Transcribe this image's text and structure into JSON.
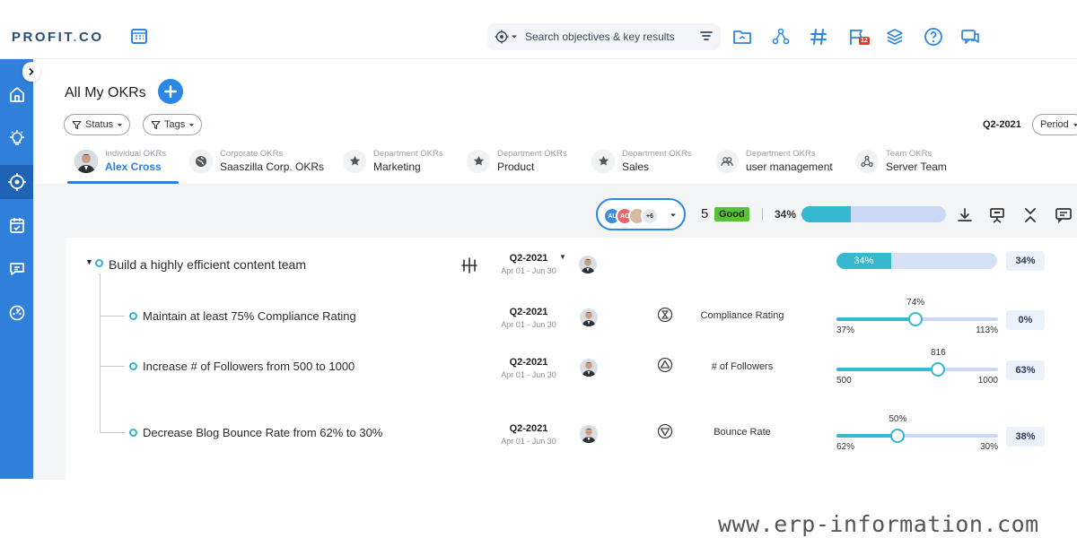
{
  "app": {
    "logo_text": "PROFIT",
    "logo_dot": ".",
    "logo_suffix": "CO"
  },
  "search": {
    "placeholder": "Search objectives & key results"
  },
  "top_icons": [
    "folder-icon",
    "hierarchy-icon",
    "hashtag-icon",
    "flag-icon",
    "layers-icon",
    "help-icon",
    "chat-icon"
  ],
  "notification_count": "12",
  "page": {
    "title": "All My OKRs",
    "filters": {
      "status": "Status",
      "tags": "Tags"
    },
    "period_value": "Q2-2021",
    "period_label": "Period"
  },
  "tabs": [
    {
      "type": "Individual OKRs",
      "name": "Alex Cross",
      "icon": "avatar",
      "active": true
    },
    {
      "type": "Corporate OKRs",
      "name": "Saaszilla Corp. OKRs",
      "icon": "globe-icon"
    },
    {
      "type": "Department OKRs",
      "name": "Marketing",
      "icon": "star-icon"
    },
    {
      "type": "Department OKRs",
      "name": "Product",
      "icon": "star-icon"
    },
    {
      "type": "Department OKRs",
      "name": "Sales",
      "icon": "star-icon"
    },
    {
      "type": "Department OKRs",
      "name": "user management",
      "icon": "users-icon"
    },
    {
      "type": "Team OKRs",
      "name": "Server Team",
      "icon": "team-icon"
    }
  ],
  "toolbar": {
    "members": [
      "AL",
      "AC"
    ],
    "members_more": "+6",
    "score": "5",
    "score_label": "Good",
    "progress_text": "34%",
    "progress": 0.34
  },
  "objective": {
    "title": "Build a highly efficient content team",
    "period": "Q2-2021",
    "dates": "Apr 01 - Jun 30",
    "progress_text": "34%",
    "progress": 0.34,
    "percent": "34%"
  },
  "key_results": [
    {
      "title": "Maintain at least 75% Compliance Rating",
      "period": "Q2-2021",
      "dates": "Apr 01 - Jun 30",
      "metric": "Compliance Rating",
      "icon": "target-icon",
      "current": "74%",
      "start": "37%",
      "target": "113%",
      "fraction": 0.49,
      "percent": "0%"
    },
    {
      "title": "Increase # of Followers from 500 to 1000",
      "period": "Q2-2021",
      "dates": "Apr 01 - Jun 30",
      "metric": "# of Followers",
      "icon": "increase-icon",
      "current": "816",
      "start": "500",
      "target": "1000",
      "fraction": 0.63,
      "percent": "63%"
    },
    {
      "title": "Decrease Blog Bounce Rate from 62% to 30%",
      "period": "Q2-2021",
      "dates": "Apr 01 - Jun 30",
      "metric": "Bounce Rate",
      "icon": "decrease-icon",
      "current": "50%",
      "start": "62%",
      "target": "30%",
      "fraction": 0.38,
      "percent": "38%"
    }
  ],
  "watermark": "www.erp-information.com",
  "colors": {
    "accent": "#2f7fdb",
    "progress": "#35b8d0",
    "good": "#56c236"
  }
}
